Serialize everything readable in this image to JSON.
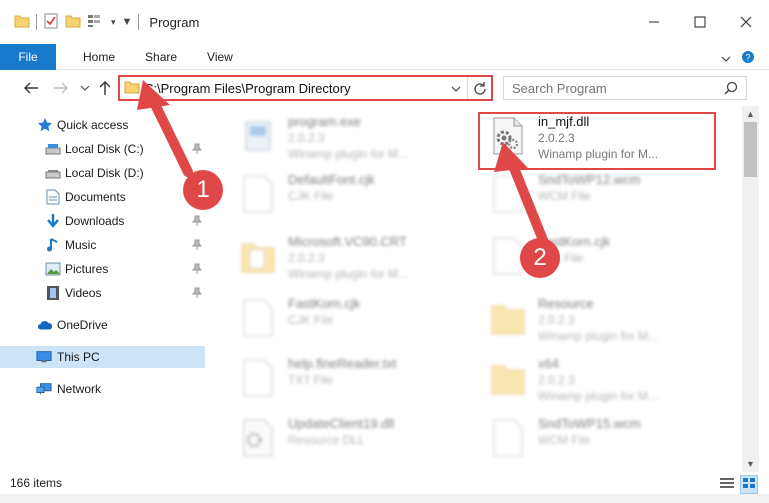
{
  "window": {
    "title": "Program",
    "minimize_glyph": "—",
    "maximize_glyph": "☐",
    "close_glyph": "✕"
  },
  "ribbon": {
    "file_tab": "File",
    "tabs": [
      "Home",
      "Share",
      "View"
    ],
    "accent": "#1979ca"
  },
  "address": {
    "path": "C:\\Program Files\\Program Directory",
    "search_placeholder": "Search Program"
  },
  "sidebar": {
    "items": [
      {
        "label": "Quick access",
        "icon": "star-icon",
        "pinned": false
      },
      {
        "label": "Local Disk (C:)",
        "icon": "drive-icon",
        "pinned": true
      },
      {
        "label": "Local Disk (D:)",
        "icon": "drive-icon",
        "pinned": false
      },
      {
        "label": "Documents",
        "icon": "documents-icon",
        "pinned": true
      },
      {
        "label": "Downloads",
        "icon": "download-arrow-icon",
        "pinned": true
      },
      {
        "label": "Music",
        "icon": "music-note-icon",
        "pinned": true
      },
      {
        "label": "Pictures",
        "icon": "pictures-icon",
        "pinned": true
      },
      {
        "label": "Videos",
        "icon": "film-icon",
        "pinned": true
      },
      {
        "label": "OneDrive",
        "icon": "cloud-icon",
        "pinned": false
      },
      {
        "label": "This PC",
        "icon": "monitor-icon",
        "pinned": false,
        "selected": true
      },
      {
        "label": "Network",
        "icon": "network-icon",
        "pinned": false
      }
    ]
  },
  "files": [
    {
      "name": "program.exe",
      "line2": "2.0.2.3",
      "line3": "Winamp plugin for M...",
      "icon": "exe-icon"
    },
    {
      "name": "in_mjf.dll",
      "line2": "2.0.2.3",
      "line3": "Winamp plugin for M...",
      "icon": "dll-gear-icon",
      "highlighted": true
    },
    {
      "name": "DefaultFont.cjk",
      "line2": "CJK File",
      "line3": "",
      "icon": "blank-file-icon"
    },
    {
      "name": "SndToWP12.wcm",
      "line2": "WCM File",
      "line3": "",
      "icon": "blank-file-icon"
    },
    {
      "name": "Microsoft.VC90.CRT",
      "line2": "2.0.2.3",
      "line3": "Winamp plugin for M...",
      "icon": "folder-icon"
    },
    {
      "name": "FastKorn.cjk",
      "line2": "CJK File",
      "line3": "",
      "icon": "blank-file-icon"
    },
    {
      "name": "FastKorn.cjk",
      "line2": "CJK File",
      "line3": "",
      "icon": "blank-file-icon"
    },
    {
      "name": "Resource",
      "line2": "2.0.2.3",
      "line3": "Winamp plugin for M...",
      "icon": "folder-icon"
    },
    {
      "name": "help.fineReader.txt",
      "line2": "TXT File",
      "line3": "",
      "icon": "blank-file-icon"
    },
    {
      "name": "x64",
      "line2": "2.0.2.3",
      "line3": "Winamp plugin for M...",
      "icon": "folder-icon"
    },
    {
      "name": "UpdateClient19.dll",
      "line2": "Resource DLL",
      "line3": "",
      "icon": "dll-gear-icon"
    },
    {
      "name": "SndToWP15.wcm",
      "line2": "WCM File",
      "line3": "",
      "icon": "blank-file-icon"
    }
  ],
  "status": {
    "item_count": "166 items"
  },
  "annotations": [
    {
      "number": "1",
      "color": "#e04848"
    },
    {
      "number": "2",
      "color": "#e04848"
    }
  ]
}
